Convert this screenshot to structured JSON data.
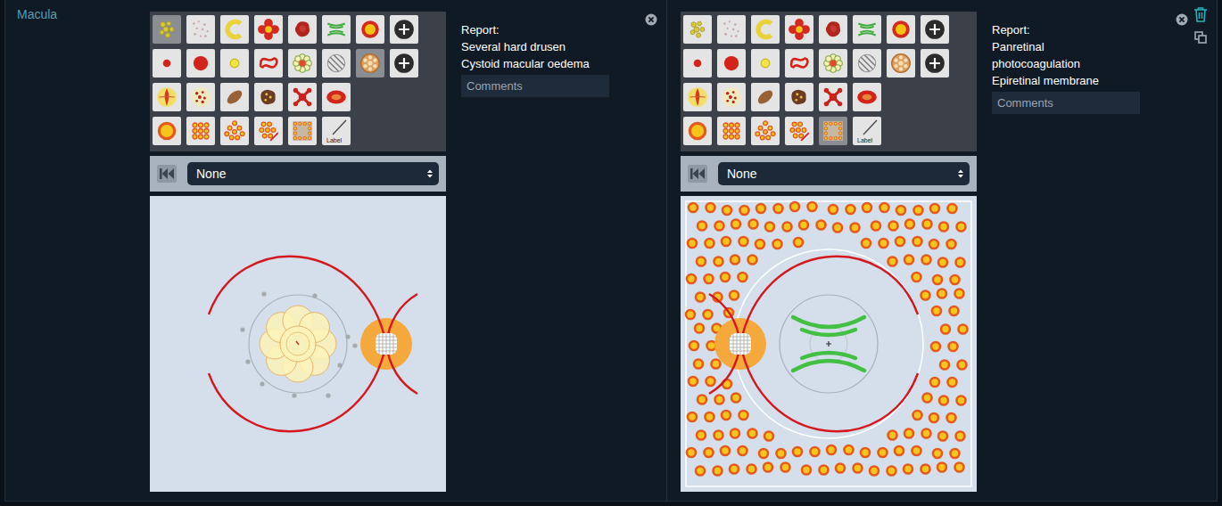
{
  "section": {
    "title": "Macula"
  },
  "panels": [
    {
      "toolbar": {
        "rows": [
          [
            {
              "kind": "drusen-cluster",
              "selected": true
            },
            {
              "kind": "drusen-scattered",
              "selected": false
            },
            {
              "kind": "c-shape",
              "selected": false
            },
            {
              "kind": "haemorrhage-flower",
              "selected": false
            },
            {
              "kind": "blot",
              "selected": false
            },
            {
              "kind": "erm",
              "selected": false
            },
            {
              "kind": "target",
              "selected": false
            },
            {
              "kind": "add",
              "selected": false
            }
          ],
          [
            {
              "kind": "dot-small-red",
              "selected": false
            },
            {
              "kind": "dot-large-red",
              "selected": false
            },
            {
              "kind": "dot-yellow",
              "selected": false
            },
            {
              "kind": "vessel-loop",
              "selected": false
            },
            {
              "kind": "cmo",
              "selected": false
            },
            {
              "kind": "hatch",
              "selected": false
            },
            {
              "kind": "geographic",
              "selected": true
            },
            {
              "kind": "add",
              "selected": false
            }
          ],
          [
            {
              "kind": "flame",
              "selected": false
            },
            {
              "kind": "mottled",
              "selected": false
            },
            {
              "kind": "leaf",
              "selected": false
            },
            {
              "kind": "pigment",
              "selected": false
            },
            {
              "kind": "star",
              "selected": false
            },
            {
              "kind": "oval",
              "selected": false
            }
          ],
          [
            {
              "kind": "laser-spot",
              "selected": false
            },
            {
              "kind": "laser-cluster",
              "selected": false
            },
            {
              "kind": "laser-scatter",
              "selected": false
            },
            {
              "kind": "laser-line",
              "selected": false
            },
            {
              "kind": "prp",
              "selected": false
            },
            {
              "kind": "label",
              "label": "Label",
              "selected": false
            }
          ]
        ]
      },
      "control": {
        "value": "None"
      },
      "canvas": {
        "kind": "disc-right",
        "doodles": [
          "arcades",
          "optic-disc",
          "fovea",
          "cmo",
          "hard-drusen"
        ]
      },
      "report": {
        "heading": "Report:",
        "lines": [
          "Several hard drusen",
          "Cystoid macular oedema"
        ]
      },
      "comments": {
        "placeholder": "Comments"
      },
      "actions": [
        "close"
      ]
    },
    {
      "toolbar": {
        "rows": [
          [
            {
              "kind": "drusen-cluster",
              "selected": false
            },
            {
              "kind": "drusen-scattered",
              "selected": false
            },
            {
              "kind": "c-shape",
              "selected": false
            },
            {
              "kind": "haemorrhage-flower",
              "selected": false
            },
            {
              "kind": "blot",
              "selected": false
            },
            {
              "kind": "erm",
              "selected": false
            },
            {
              "kind": "target",
              "selected": false
            },
            {
              "kind": "add",
              "selected": false
            }
          ],
          [
            {
              "kind": "dot-small-red",
              "selected": false
            },
            {
              "kind": "dot-large-red",
              "selected": false
            },
            {
              "kind": "dot-yellow",
              "selected": false
            },
            {
              "kind": "vessel-loop",
              "selected": false
            },
            {
              "kind": "cmo",
              "selected": false
            },
            {
              "kind": "hatch",
              "selected": false
            },
            {
              "kind": "geographic",
              "selected": false
            },
            {
              "kind": "add",
              "selected": false
            }
          ],
          [
            {
              "kind": "flame",
              "selected": false
            },
            {
              "kind": "mottled",
              "selected": false
            },
            {
              "kind": "leaf",
              "selected": false
            },
            {
              "kind": "pigment",
              "selected": false
            },
            {
              "kind": "star",
              "selected": false
            },
            {
              "kind": "oval",
              "selected": false
            }
          ],
          [
            {
              "kind": "laser-spot",
              "selected": false
            },
            {
              "kind": "laser-cluster",
              "selected": false
            },
            {
              "kind": "laser-scatter",
              "selected": false
            },
            {
              "kind": "laser-line",
              "selected": false
            },
            {
              "kind": "prp",
              "selected": true
            },
            {
              "kind": "label",
              "label": "Label",
              "selected": false
            }
          ]
        ]
      },
      "control": {
        "value": "None"
      },
      "canvas": {
        "kind": "disc-left",
        "doodles": [
          "prp",
          "arcades",
          "optic-disc",
          "fovea",
          "erm"
        ]
      },
      "report": {
        "heading": "Report:",
        "lines": [
          "Panretinal",
          "photocoagulation",
          "Epiretinal membrane"
        ]
      },
      "comments": {
        "placeholder": "Comments"
      },
      "actions": [
        "close",
        "delete",
        "copy"
      ]
    }
  ]
}
